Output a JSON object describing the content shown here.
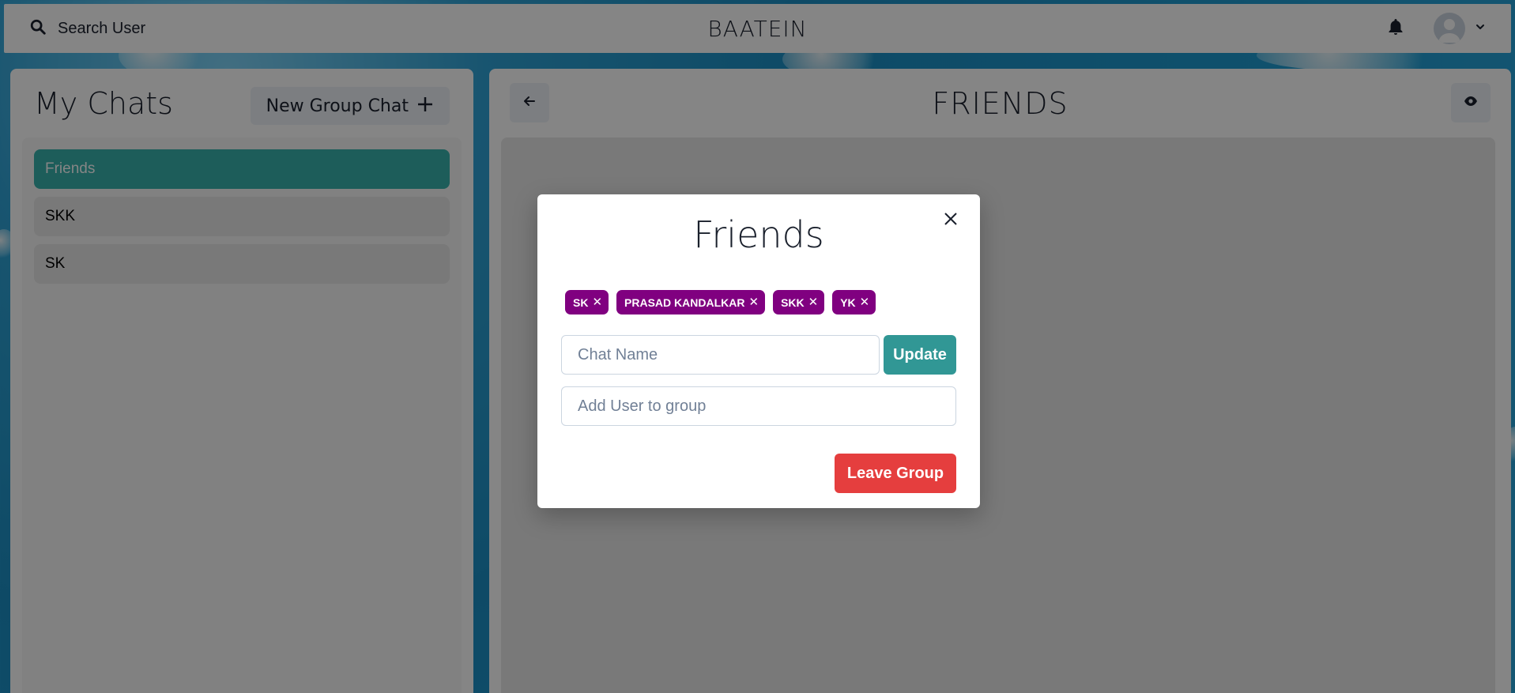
{
  "header": {
    "search_label": "Search User",
    "app_title": "BAATEIN"
  },
  "sidebar": {
    "title": "My Chats",
    "new_group_label": "New Group Chat",
    "chats": [
      {
        "name": "Friends",
        "active": true
      },
      {
        "name": "SKK",
        "active": false
      },
      {
        "name": "SK",
        "active": false
      }
    ]
  },
  "chat": {
    "title": "FRIENDS"
  },
  "modal": {
    "title": "Friends",
    "members": [
      "SK",
      "PRASAD KANDALKAR",
      "SKK",
      "YK"
    ],
    "chat_name_placeholder": "Chat Name",
    "update_label": "Update",
    "add_user_placeholder": "Add User to group",
    "leave_label": "Leave Group"
  },
  "colors": {
    "active_chat": "#38b2ac",
    "member_badge": "#800080",
    "update_button": "#319795",
    "leave_button": "#e53e3e"
  },
  "icons": {
    "search": "search-icon",
    "bell": "bell-icon",
    "avatar": "user-avatar-icon",
    "chevron": "chevron-down-icon",
    "plus": "plus-icon",
    "back": "arrow-left-icon",
    "eye": "eye-icon",
    "close": "close-icon"
  }
}
